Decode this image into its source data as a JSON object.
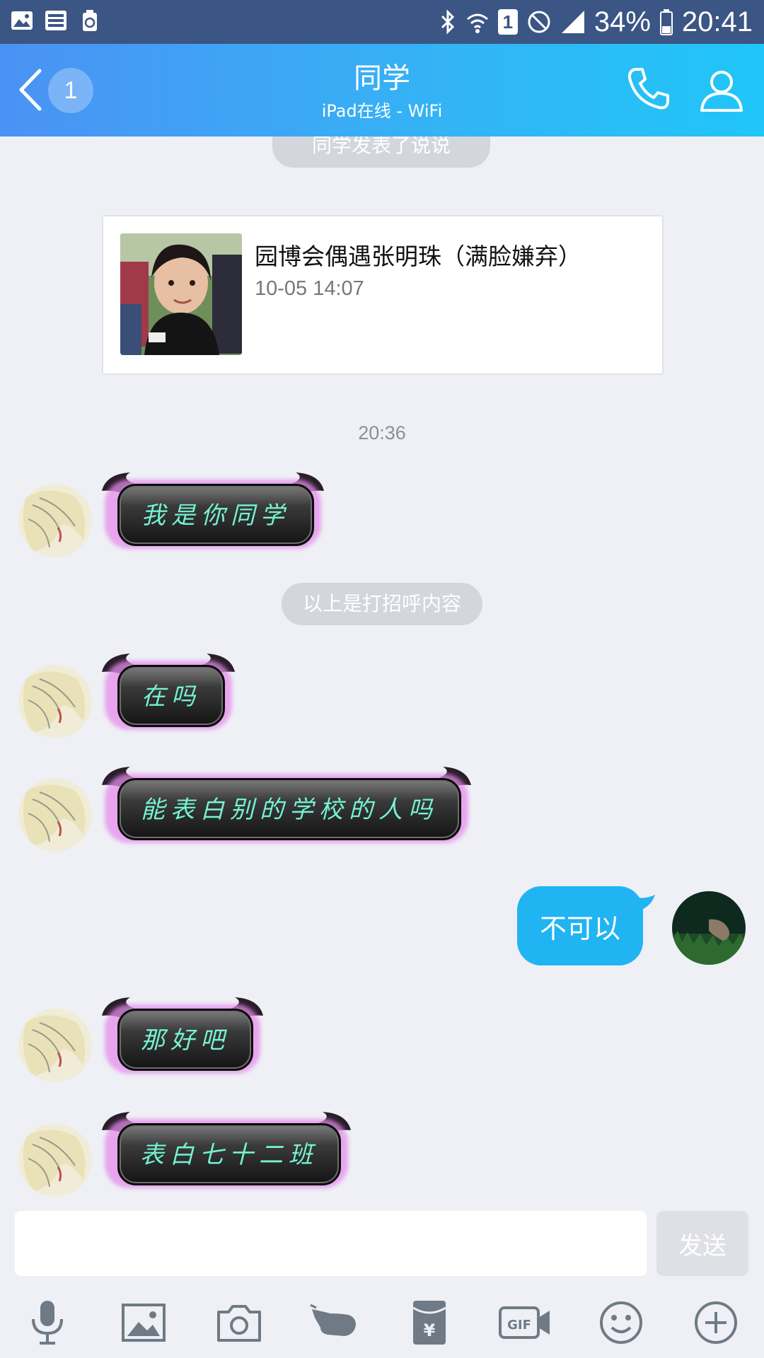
{
  "status_bar": {
    "battery": "34%",
    "time": "20:41",
    "sim_slot": "1"
  },
  "header": {
    "unread_count": "1",
    "title": "同学",
    "subtitle": "iPad在线 - WiFi"
  },
  "chat": {
    "top_notice": "同学发表了说说",
    "feed_card": {
      "title": "园博会偶遇张明珠（满脸嫌弃）",
      "date": "10-05 14:07"
    },
    "timestamp": "20:36",
    "greeting_divider": "以上是打招呼内容",
    "messages": [
      {
        "from": "other",
        "text": "我是你同学"
      },
      {
        "from": "other",
        "text": "在吗"
      },
      {
        "from": "other",
        "text": "能表白别的学校的人吗"
      },
      {
        "from": "me",
        "text": "不可以"
      },
      {
        "from": "other",
        "text": "那好吧"
      },
      {
        "from": "other",
        "text": "表白七十二班"
      }
    ]
  },
  "input_bar": {
    "value": "",
    "send_label": "发送"
  },
  "toolbar_icons": [
    "microphone-icon",
    "image-icon",
    "camera-icon",
    "poke-icon",
    "red-packet-icon",
    "gif-icon",
    "emoji-icon",
    "plus-icon"
  ],
  "colors": {
    "header_start": "#4b92f4",
    "header_end": "#20c6f7",
    "my_bubble": "#20b4f3",
    "demon_text": "#74f3d0",
    "background": "#eef0f6"
  }
}
